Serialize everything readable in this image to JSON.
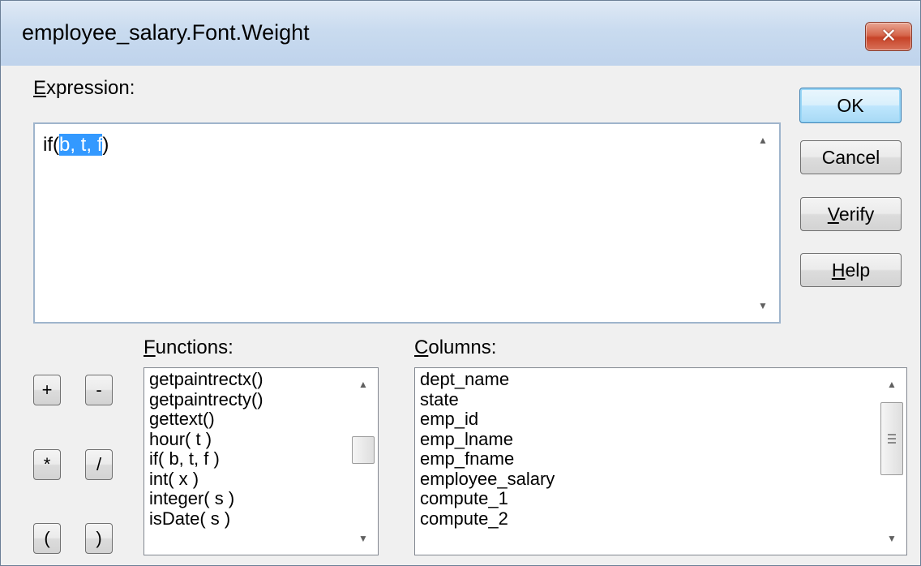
{
  "window": {
    "title": "employee_salary.Font.Weight",
    "close_glyph": "✕"
  },
  "expression": {
    "label": "Expression:",
    "label_accesskey": "E",
    "label_rest": "xpression:",
    "text_prefix": "if(",
    "text_selected": "b, t, f",
    "text_suffix": ")"
  },
  "buttons": {
    "ok": "OK",
    "cancel": "Cancel",
    "verify_key": "V",
    "verify_rest": "erify",
    "help_key": "H",
    "help_rest": "elp"
  },
  "operators": [
    "+",
    "-",
    "*",
    "/",
    "(",
    ")"
  ],
  "functions": {
    "label_key": "F",
    "label_rest": "unctions:",
    "items": [
      "getpaintrectx()",
      "getpaintrecty()",
      "gettext()",
      "hour( t )",
      "if( b, t, f )",
      "int( x )",
      "integer( s )",
      "isDate( s )"
    ],
    "scroll_position": 0.5
  },
  "columns": {
    "label_key": "C",
    "label_rest": "olumns:",
    "items": [
      "dept_name",
      "state",
      "emp_id",
      "emp_lname",
      "emp_fname",
      "employee_salary",
      "compute_1",
      "compute_2"
    ],
    "scroll_position": 0.3
  },
  "icons": {
    "scroll_up": "▲",
    "scroll_down": "▼"
  },
  "colors": {
    "selection": "#3399ff",
    "title_gradient_top": "#dfe9f5",
    "close_button": "#c74328"
  }
}
